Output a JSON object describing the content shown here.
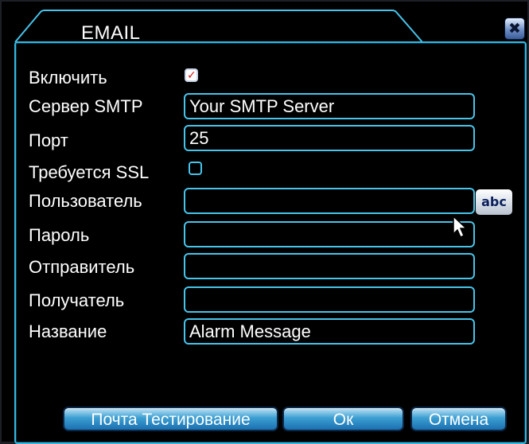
{
  "dialog": {
    "title": "EMAIL",
    "close_glyph": "✖",
    "accent_color": "#46c4ea"
  },
  "form": {
    "enable_label": "Включить",
    "enable_checked": true,
    "smtp_label": "Сервер SMTP",
    "smtp_value": "Your SMTP Server",
    "port_label": "Порт",
    "port_value": "25",
    "ssl_label": "Требуется SSL",
    "ssl_checked": false,
    "user_label": "Пользователь",
    "user_value": "",
    "keyboard_label": "abc",
    "password_label": "Пароль",
    "password_value": "",
    "sender_label": "Отправитель",
    "sender_value": "",
    "receiver_label": "Получатель",
    "receiver_value": "",
    "subject_label": "Название",
    "subject_value": "Alarm Message"
  },
  "buttons": {
    "test_label": "Почта Тестирование",
    "ok_label": "Ок",
    "cancel_label": "Отмена"
  }
}
